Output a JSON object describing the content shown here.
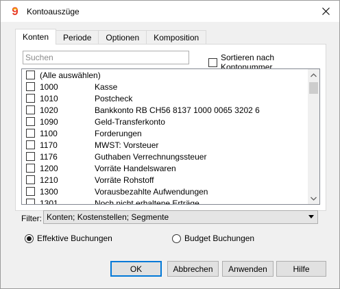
{
  "window": {
    "title": "Kontoauszüge",
    "app_icon": "banana-9-icon",
    "accent": "#e8402a"
  },
  "tabs": [
    {
      "label": "Konten",
      "active": true
    },
    {
      "label": "Periode",
      "active": false
    },
    {
      "label": "Optionen",
      "active": false
    },
    {
      "label": "Komposition",
      "active": false
    }
  ],
  "search": {
    "placeholder": "Suchen",
    "value": ""
  },
  "sort": {
    "label": "Sortieren nach Kontonummer",
    "checked": false
  },
  "accounts": [
    {
      "num": "(Alle auswählen)",
      "desc": ""
    },
    {
      "num": "1000",
      "desc": "Kasse"
    },
    {
      "num": "1010",
      "desc": "Postcheck"
    },
    {
      "num": "1020",
      "desc": "Bankkonto RB CH56 8137 1000 0065 3202 6"
    },
    {
      "num": "1090",
      "desc": "Geld-Transferkonto"
    },
    {
      "num": "1100",
      "desc": "Forderungen"
    },
    {
      "num": "1170",
      "desc": "MWST: Vorsteuer"
    },
    {
      "num": "1176",
      "desc": "Guthaben Verrechnungssteuer"
    },
    {
      "num": "1200",
      "desc": "Vorräte Handelswaren"
    },
    {
      "num": "1210",
      "desc": "Vorräte Rohstoff"
    },
    {
      "num": "1300",
      "desc": "Vorausbezahlte Aufwendungen"
    },
    {
      "num": "1301",
      "desc": "Noch nicht erhaltene Erträge"
    }
  ],
  "filter": {
    "label": "Filter:",
    "value": "Konten; Kostenstellen; Segmente"
  },
  "radios": {
    "effective": {
      "label": "Effektive Buchungen",
      "selected": true
    },
    "budget": {
      "label": "Budget Buchungen",
      "selected": false
    }
  },
  "buttons": {
    "ok": "OK",
    "cancel": "Abbrechen",
    "apply": "Anwenden",
    "help": "Hilfe"
  }
}
